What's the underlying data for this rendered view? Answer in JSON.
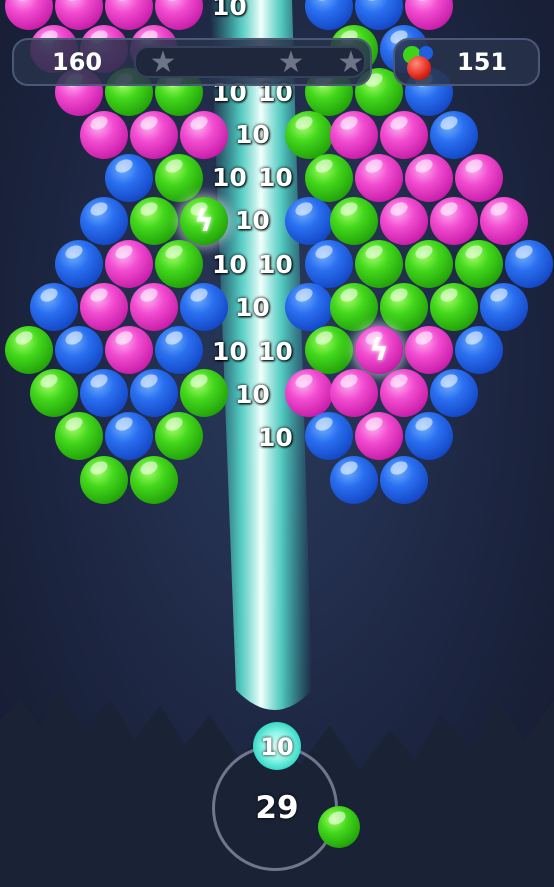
{
  "hud": {
    "score": "160",
    "bubbles_left": "151",
    "stars": 3
  },
  "shooter": {
    "shots_remaining": "29",
    "current_points": "10",
    "next_bubble_color": "green"
  },
  "popup_points": [
    "10",
    "10",
    "10",
    "10",
    "10",
    "10",
    "10",
    "10",
    "10",
    "10",
    "10",
    "10",
    "10",
    "10",
    "10",
    "10"
  ],
  "colors": {
    "green": "#3fd41a",
    "blue": "#1f5fe0",
    "pink": "#e63bc4",
    "laser": "#8ff6e8"
  },
  "powerups": [
    "lightning-bubble",
    "lightning-bubble"
  ]
}
